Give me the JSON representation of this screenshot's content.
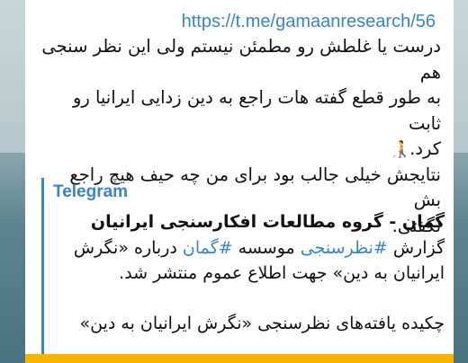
{
  "message": {
    "link": "https://t.me/gamaanresearch/56",
    "lines": [
      "درست یا غلطش رو مطمئن نیستم ولی این نظر سنجی هم",
      "به طور قطع گفته هات راجع به دین زدایی ایرانیا رو ثابت",
      "کرد."
    ],
    "emoji": "walking-person-with-cane",
    "lines2": [
      "نتایجش خیلی جالب بود برای من چه حیف هیچ راجع بش",
      "نگفتی."
    ]
  },
  "preview": {
    "site": "Telegram",
    "title": "گمان - گروه مطالعات افکارسنجی ایرانیان",
    "desc_prefix": "گزارش ",
    "tag1": "#نظرسنجی",
    "desc_mid": " موسسه ",
    "tag2": "#گمان",
    "desc_rest": " درباره «نگرش",
    "desc_line2": "ایرانیان به دین» جهت اطلاع عموم منتشر شد.",
    "summary": "چکیده یافته‌های نظرسنجی «نگرش ایرانیان به دین»"
  },
  "colors": {
    "accent": "#3a84c7",
    "highlight": "#f5b400"
  }
}
